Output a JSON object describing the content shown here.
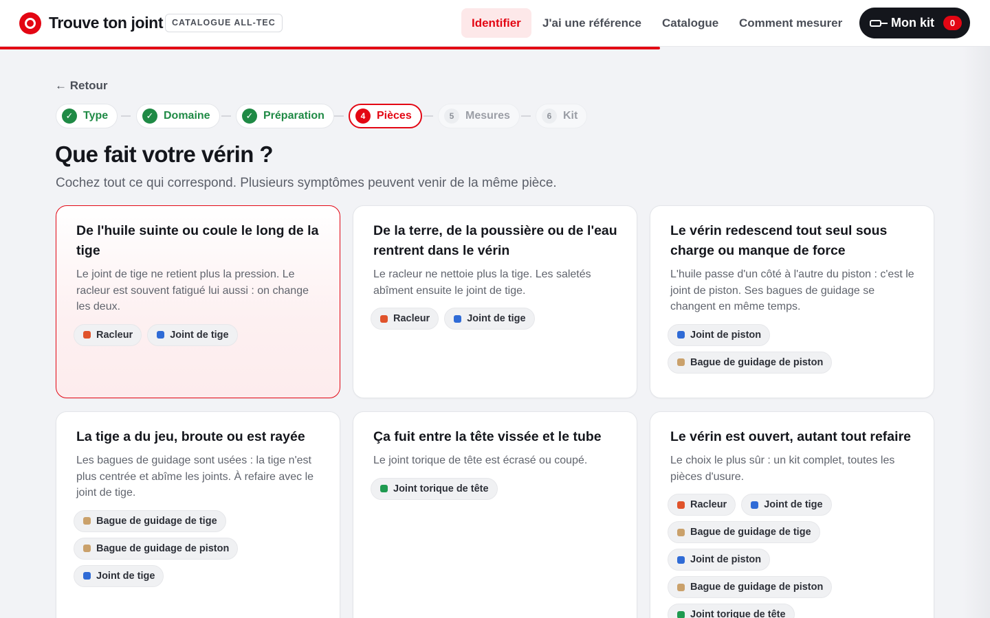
{
  "header": {
    "brand": "Trouve ton joint",
    "badge": "CATALOGUE ALL-TEC",
    "nav": [
      "Identifier",
      "J'ai une référence",
      "Catalogue",
      "Comment mesurer"
    ],
    "kit_label": "Mon kit",
    "kit_count": "0",
    "progress_fraction": 0.667
  },
  "back_label": "← Retour",
  "steps": [
    {
      "num": "✓",
      "label": "Type",
      "state": "done"
    },
    {
      "num": "✓",
      "label": "Domaine",
      "state": "done"
    },
    {
      "num": "✓",
      "label": "Préparation",
      "state": "done"
    },
    {
      "num": "4",
      "label": "Pièces",
      "state": "current"
    },
    {
      "num": "5",
      "label": "Mesures",
      "state": "todo"
    },
    {
      "num": "6",
      "label": "Kit",
      "state": "todo"
    }
  ],
  "title": "Que fait votre vérin ?",
  "subtitle": "Cochez tout ce qui correspond. Plusieurs symptômes peuvent venir de la même pièce.",
  "part_colors": {
    "Racleur": "#e0532b",
    "Joint de tige": "#2f6bd6",
    "Joint de piston": "#2f6bd6",
    "Bague de guidage de piston": "#caa16b",
    "Bague de guidage de tige": "#caa16b",
    "Joint torique de tête": "#1f9a50"
  },
  "cards": [
    {
      "title": "De l'huile suinte ou coule le long de la tige",
      "desc": "Le joint de tige ne retient plus la pression. Le racleur est souvent fatigué lui aussi : on change les deux.",
      "tags": [
        "Racleur",
        "Joint de tige"
      ],
      "selected": true
    },
    {
      "title": "De la terre, de la poussière ou de l'eau rentrent dans le vérin",
      "desc": "Le racleur ne nettoie plus la tige. Les saletés abîment ensuite le joint de tige.",
      "tags": [
        "Racleur",
        "Joint de tige"
      ],
      "selected": false
    },
    {
      "title": "Le vérin redescend tout seul sous charge ou manque de force",
      "desc": "L'huile passe d'un côté à l'autre du piston : c'est le joint de piston. Ses bagues de guidage se changent en même temps.",
      "tags": [
        "Joint de piston",
        "Bague de guidage de piston"
      ],
      "selected": false
    },
    {
      "title": "La tige a du jeu, broute ou est rayée",
      "desc": "Les bagues de guidage sont usées : la tige n'est plus centrée et abîme les joints. À refaire avec le joint de tige.",
      "tags": [
        "Bague de guidage de tige",
        "Bague de guidage de piston",
        "Joint de tige"
      ],
      "selected": false
    },
    {
      "title": "Ça fuit entre la tête vissée et le tube",
      "desc": "Le joint torique de tête est écrasé ou coupé.",
      "tags": [
        "Joint torique de tête"
      ],
      "selected": false
    },
    {
      "title": "Le vérin est ouvert, autant tout refaire",
      "desc": "Le choix le plus sûr : un kit complet, toutes les pièces d'usure.",
      "tags": [
        "Racleur",
        "Joint de tige",
        "Bague de guidage de tige",
        "Joint de piston",
        "Bague de guidage de piston",
        "Joint torique de tête"
      ],
      "selected": false
    }
  ]
}
